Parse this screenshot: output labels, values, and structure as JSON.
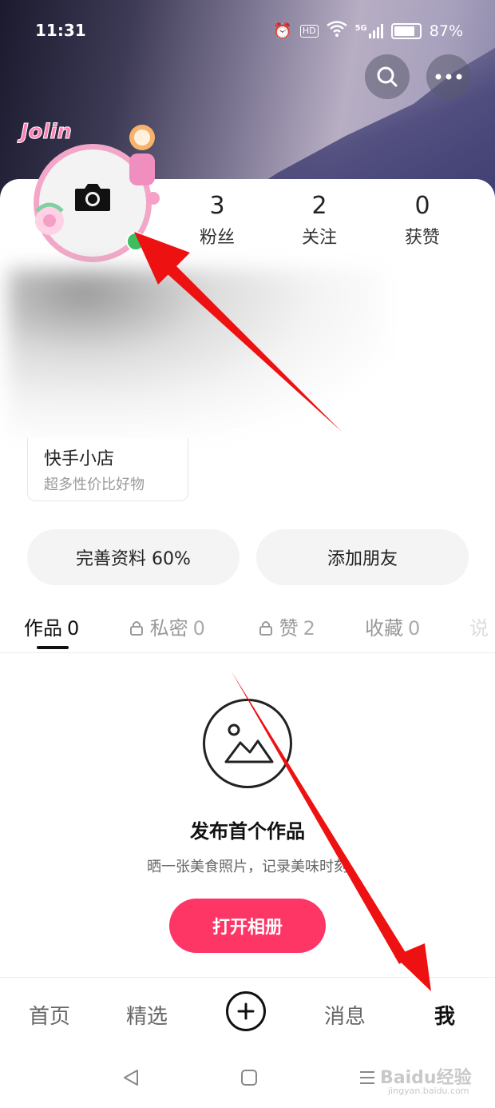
{
  "status_bar": {
    "time": "11:31",
    "hd": "HD",
    "network": "5G",
    "battery": "87%"
  },
  "header": {
    "search_icon": "search-icon",
    "more_icon": "more-icon"
  },
  "profile": {
    "avatar_frame_text": "Jolin",
    "camera_icon": "camera-icon",
    "stats": [
      {
        "value": "3",
        "label": "粉丝"
      },
      {
        "value": "2",
        "label": "关注"
      },
      {
        "value": "0",
        "label": "获赞"
      }
    ]
  },
  "shop": {
    "title": "快手小店",
    "subtitle": "超多性价比好物"
  },
  "actions": {
    "complete_profile": "完善资料 60%",
    "add_friends": "添加朋友"
  },
  "tabs": [
    {
      "label": "作品",
      "count": "0",
      "locked": false,
      "active": true
    },
    {
      "label": "私密",
      "count": "0",
      "locked": true,
      "active": false
    },
    {
      "label": "赞",
      "count": "2",
      "locked": true,
      "active": false
    },
    {
      "label": "收藏",
      "count": "0",
      "locked": false,
      "active": false
    },
    {
      "label": "说",
      "count": "",
      "locked": false,
      "active": false
    }
  ],
  "empty_state": {
    "icon": "image-icon",
    "title": "发布首个作品",
    "subtitle": "晒一张美食照片，记录美味时刻",
    "button": "打开相册"
  },
  "bottom_nav": {
    "items": [
      "首页",
      "精选",
      "消息",
      "我"
    ],
    "active": "我",
    "plus_icon": "plus-icon"
  },
  "watermark": {
    "text": "Baidu经验",
    "sub": "jingyan.baidu.com"
  },
  "colors": {
    "accent": "#fe3666",
    "arrow": "#ee1111",
    "avatar_ring": "#f3a7c8"
  }
}
